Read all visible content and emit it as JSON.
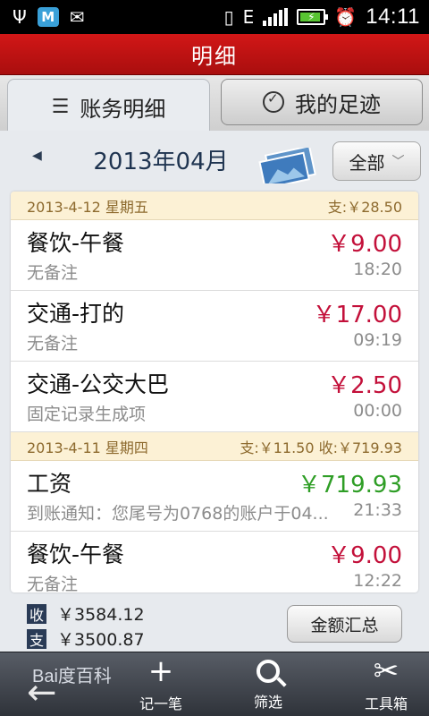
{
  "statusbar": {
    "time": "14:11",
    "network": "E",
    "icons": [
      "usb-icon",
      "app-m-icon",
      "mail-icon",
      "vibrate-icon",
      "data-e-icon",
      "signal-icon",
      "battery-charging-icon",
      "alarm-icon"
    ]
  },
  "header": {
    "title": "明细"
  },
  "tabs": [
    {
      "label": "账务明细",
      "icon": "list-icon",
      "active": true
    },
    {
      "label": "我的足迹",
      "icon": "clock-check-icon",
      "active": false
    }
  ],
  "month": {
    "label": "2013年04月"
  },
  "filter": {
    "label": "全部"
  },
  "days": [
    {
      "date": "2013-4-12 星期五",
      "summary": "支:￥28.50",
      "items": [
        {
          "category": "餐饮-午餐",
          "amount": "￥9.00",
          "type": "expense",
          "note": "无备注",
          "time": "18:20"
        },
        {
          "category": "交通-打的",
          "amount": "￥17.00",
          "type": "expense",
          "note": "无备注",
          "time": "09:19"
        },
        {
          "category": "交通-公交大巴",
          "amount": "￥2.50",
          "type": "expense",
          "note": "固定记录生成项",
          "time": "00:00"
        }
      ]
    },
    {
      "date": "2013-4-11 星期四",
      "summary": "支:￥11.50 收:￥719.93",
      "items": [
        {
          "category": "工资",
          "amount": "￥719.93",
          "type": "income",
          "note": "到账通知：您尾号为0768的账户于04...",
          "time": "21:33"
        },
        {
          "category": "餐饮-午餐",
          "amount": "￥9.00",
          "type": "expense",
          "note": "无备注",
          "time": "12:22"
        }
      ]
    }
  ],
  "summary": {
    "income_badge": "收",
    "income_value": "￥3584.12",
    "expense_badge": "支",
    "expense_value": "￥3500.87",
    "total_button": "金额汇总"
  },
  "toolbar": {
    "watermark": "Bai度百科",
    "add_label": "记一笔",
    "filter_label": "筛选",
    "tools_label": "工具箱"
  },
  "colors": {
    "title_red": "#c41212",
    "expense": "#c3103a",
    "income": "#2f9e26",
    "day_header_bg": "#fcf1d5"
  }
}
